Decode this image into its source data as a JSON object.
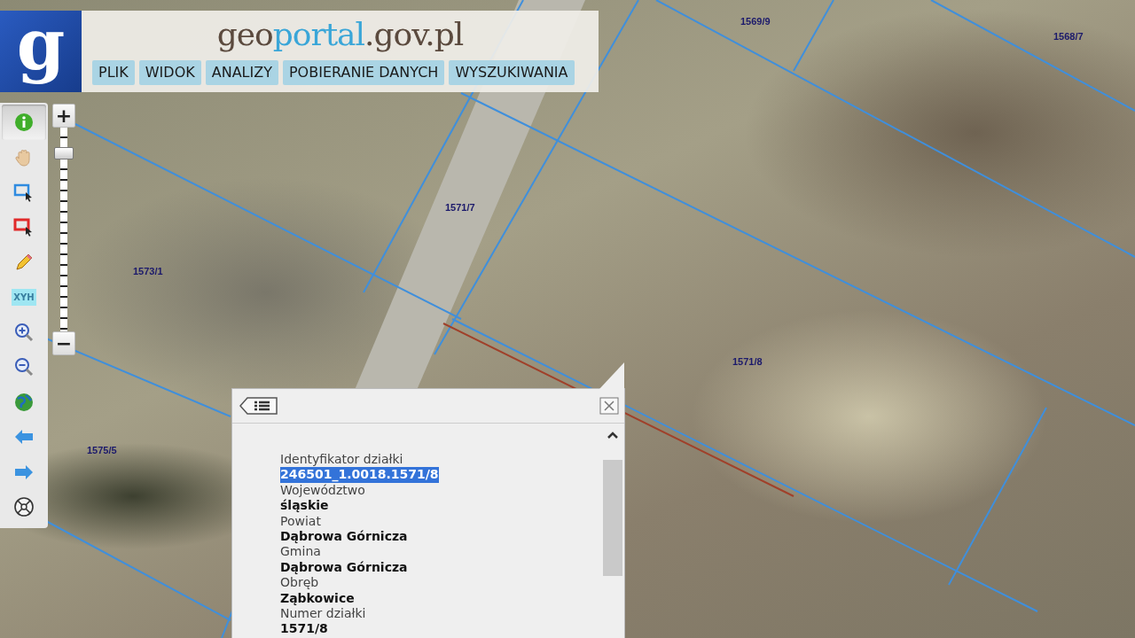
{
  "header": {
    "logo_letter": "g",
    "title": [
      {
        "text": "geo",
        "accent": false
      },
      {
        "text": "portal",
        "accent": true
      },
      {
        "text": ".gov.pl",
        "accent": false
      }
    ],
    "menu": [
      "PLIK",
      "WIDOK",
      "ANALIZY",
      "POBIERANIE DANYCH",
      "WYSZUKIWANIA"
    ]
  },
  "toolbar": [
    {
      "kind": "info",
      "selected": true
    },
    {
      "kind": "pan",
      "selected": false
    },
    {
      "kind": "select",
      "selected": false
    },
    {
      "kind": "unselect",
      "selected": false
    },
    {
      "kind": "pencil",
      "selected": false
    },
    {
      "kind": "xyh",
      "label": "XYH",
      "selected": false
    },
    {
      "kind": "zoom-in",
      "selected": false
    },
    {
      "kind": "zoom-out",
      "selected": false
    },
    {
      "kind": "globe",
      "selected": false
    },
    {
      "kind": "back",
      "selected": false
    },
    {
      "kind": "forward",
      "selected": false
    },
    {
      "kind": "extent",
      "selected": false
    }
  ],
  "zoom": {
    "plus": "+",
    "minus": "−",
    "level": 0.9
  },
  "map": {
    "parcel_labels": [
      "1569/9",
      "1568/7",
      "1571/7",
      "1573/1",
      "1571/8",
      "1575/5"
    ]
  },
  "popup": {
    "fields": [
      {
        "label": "Identyfikator działki",
        "value": "246501_1.0018.1571/8",
        "highlighted": true
      },
      {
        "label": "Województwo",
        "value": "śląskie",
        "highlighted": false
      },
      {
        "label": "Powiat",
        "value": "Dąbrowa Górnicza",
        "highlighted": false
      },
      {
        "label": "Gmina",
        "value": "Dąbrowa Górnicza",
        "highlighted": false
      },
      {
        "label": "Obręb",
        "value": "Ząbkowice",
        "highlighted": false
      },
      {
        "label": "Numer działki",
        "value": "1571/8",
        "highlighted": false
      }
    ]
  }
}
